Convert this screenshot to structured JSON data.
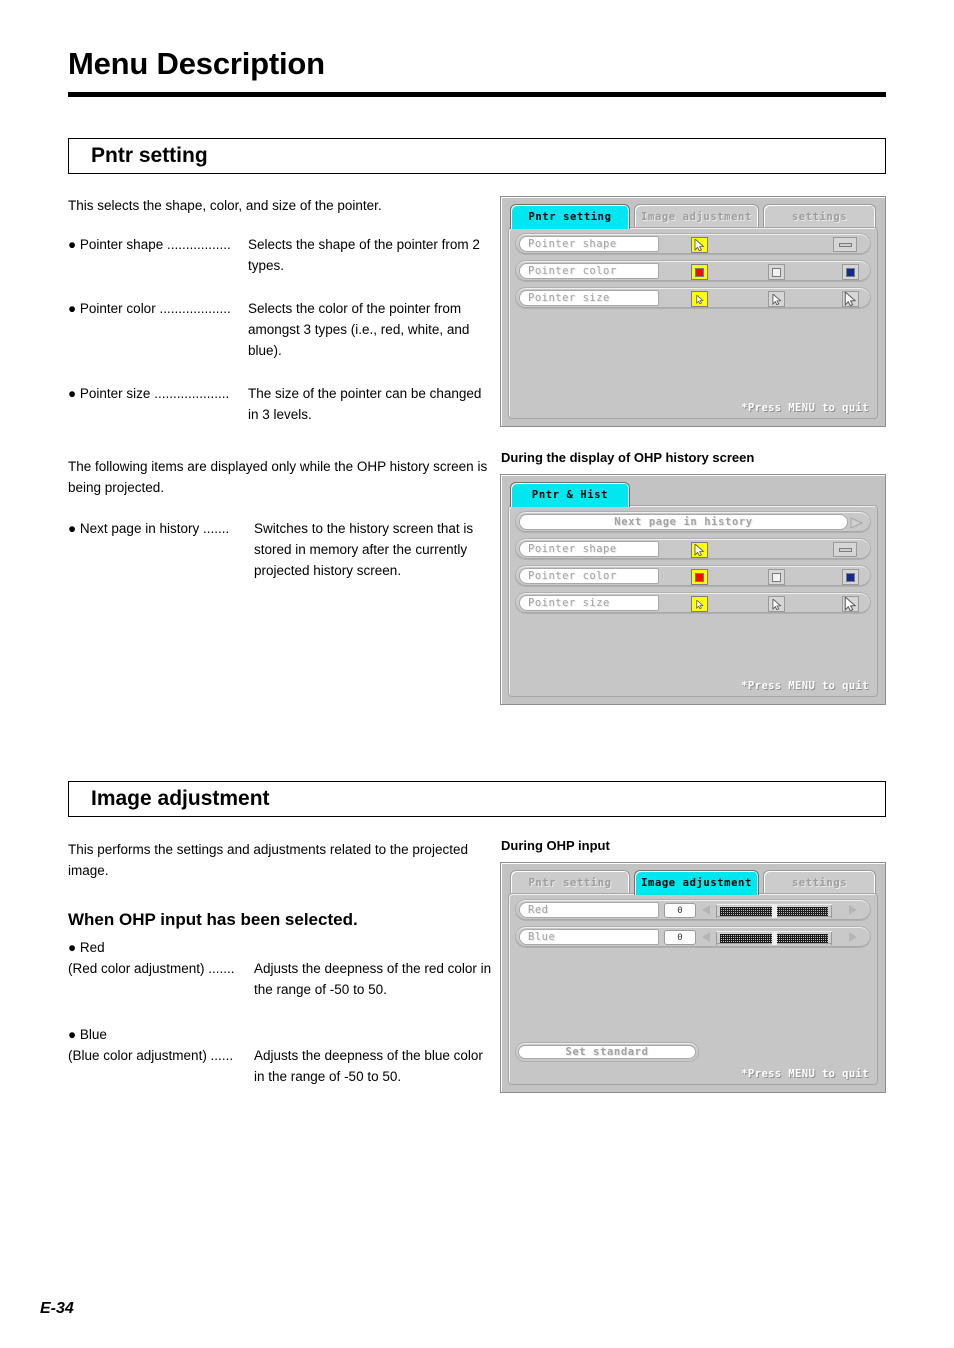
{
  "page": {
    "title": "Menu Description",
    "number": "E-34"
  },
  "sections": [
    {
      "heading": "Pntr setting",
      "intro": "This selects the shape, color, and size of the pointer.",
      "items": [
        {
          "term": "● Pointer shape .................",
          "desc": "Selects the shape of the pointer from 2 types."
        },
        {
          "term": "● Pointer color ...................",
          "desc": "Selects the color of the pointer from amongst 3 types (i.e., red, white, and blue)."
        },
        {
          "term": "● Pointer size ....................",
          "desc": "The size of the pointer can be changed in 3 levels."
        }
      ],
      "note": "The following items are displayed only while the OHP history screen is being projected.",
      "items2": [
        {
          "term": "● Next page in history .......",
          "desc": "Switches to the history screen that is stored in memory after the currently projected history screen."
        }
      ]
    },
    {
      "heading": "Image adjustment",
      "intro": "This performs the settings and adjustments related to the projected image.",
      "subhead": "When OHP input has been selected.",
      "items": [
        {
          "bullet": "● Red",
          "term": "(Red color adjustment) .......",
          "desc": "Adjusts the deepness of the red color in the range of -50 to 50."
        },
        {
          "bullet": "● Blue",
          "term": "(Blue color adjustment) ......",
          "desc": "Adjusts the deepness of the blue color in the range of -50 to 50."
        }
      ]
    }
  ],
  "captions": {
    "history": "During the display of OHP history screen",
    "ohp_input": "During OHP input"
  },
  "osd1": {
    "tabs": [
      {
        "label": "Pntr setting",
        "active": true
      },
      {
        "label": "Image adjustment",
        "active": false
      },
      {
        "label": "settings",
        "active": false
      }
    ],
    "rows": [
      {
        "label": "Pointer shape",
        "type": "shape"
      },
      {
        "label": "Pointer color",
        "type": "color"
      },
      {
        "label": "Pointer size",
        "type": "size"
      }
    ],
    "footer": "*Press MENU to quit"
  },
  "osd2": {
    "tabs": [
      {
        "label": "Pntr & Hist",
        "active": true
      }
    ],
    "wide_button": "Next page in history",
    "rows": [
      {
        "label": "Pointer shape",
        "type": "shape"
      },
      {
        "label": "Pointer color",
        "type": "color"
      },
      {
        "label": "Pointer size",
        "type": "size"
      }
    ],
    "footer": "*Press MENU to quit"
  },
  "osd3": {
    "tabs": [
      {
        "label": "Pntr setting",
        "active": false
      },
      {
        "label": "Image adjustment",
        "active": true
      },
      {
        "label": "settings",
        "active": false
      }
    ],
    "sliders": [
      {
        "label": "Red",
        "value": "0"
      },
      {
        "label": "Blue",
        "value": "0"
      }
    ],
    "set_standard": "Set standard",
    "footer": "*Press MENU to quit"
  },
  "colors": {
    "active_tab": "#00e7f0",
    "selected_chip": "#ffff00",
    "red_swatch": "#ee1100",
    "white_swatch": "#f2f2f2",
    "blue_swatch": "#142a8e",
    "panel_gray": "#c6c6c6"
  }
}
